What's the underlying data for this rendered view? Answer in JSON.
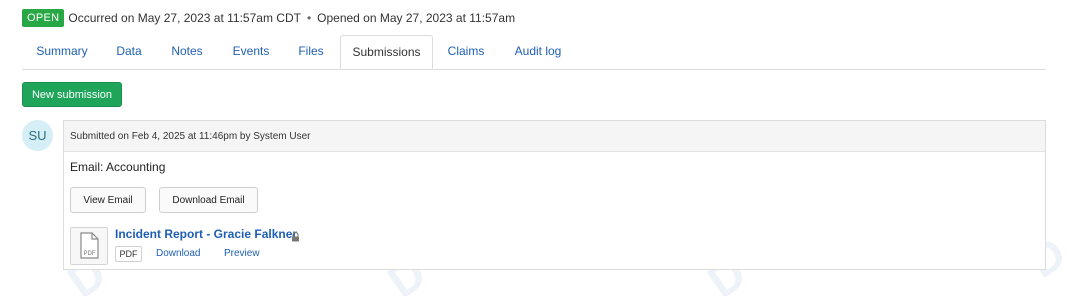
{
  "status": {
    "badge": "OPEN",
    "occurred": "Occurred on May 27, 2023 at 11:57am CDT",
    "separator": "•",
    "opened": "Opened on May 27, 2023 at 11:57am"
  },
  "tabs": [
    {
      "label": "Summary"
    },
    {
      "label": "Data"
    },
    {
      "label": "Notes"
    },
    {
      "label": "Events"
    },
    {
      "label": "Files"
    },
    {
      "label": "Submissions"
    },
    {
      "label": "Claims"
    },
    {
      "label": "Audit log"
    }
  ],
  "active_tab": "Submissions",
  "new_submission_label": "New submission",
  "submission": {
    "avatar_initials": "SU",
    "header": "Submitted on Feb 4, 2025 at 11:46pm by System User",
    "subject": "Email: Accounting",
    "view_email_label": "View Email",
    "download_email_label": "Download Email",
    "file": {
      "name": "Incident Report - Gracie Falkner",
      "type": "PDF",
      "icon_label": "PDF",
      "download_label": "Download",
      "preview_label": "Preview"
    }
  },
  "colors": {
    "open_badge": "#28a745",
    "primary_button": "#1fa55a",
    "link": "#1f5fb3"
  },
  "icons": [
    "pdf-file-icon",
    "lock-icon"
  ]
}
